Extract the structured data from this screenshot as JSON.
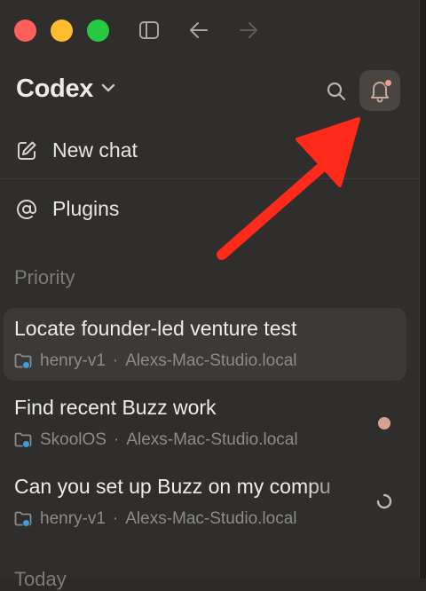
{
  "app": {
    "title": "Codex"
  },
  "nav": {
    "new_chat": "New chat",
    "plugins": "Plugins"
  },
  "sections": {
    "priority": "Priority",
    "today": "Today"
  },
  "threads": [
    {
      "title": "Locate founder-led venture test",
      "project": "henry-v1",
      "host": "Alexs-Mac-Studio.local",
      "status": "none",
      "selected": true
    },
    {
      "title": "Find recent Buzz work",
      "project": "SkoolOS",
      "host": "Alexs-Mac-Studio.local",
      "status": "unread"
    },
    {
      "title": "Can you set up Buzz on my compu",
      "project": "henry-v1",
      "host": "Alexs-Mac-Studio.local",
      "status": "running"
    }
  ],
  "separator": "·",
  "icons": {
    "sidebar_toggle": "sidebar-toggle-icon",
    "back": "arrow-left-icon",
    "forward": "arrow-right-icon",
    "search": "search-icon",
    "notifications": "bell-icon",
    "new_chat": "compose-icon",
    "plugins": "at-sign-icon",
    "folder": "folder-icon"
  },
  "colors": {
    "unread_dot": "#d4a28f",
    "annotation_arrow": "#ff2a1a",
    "notification_badge": "#e8a493"
  }
}
